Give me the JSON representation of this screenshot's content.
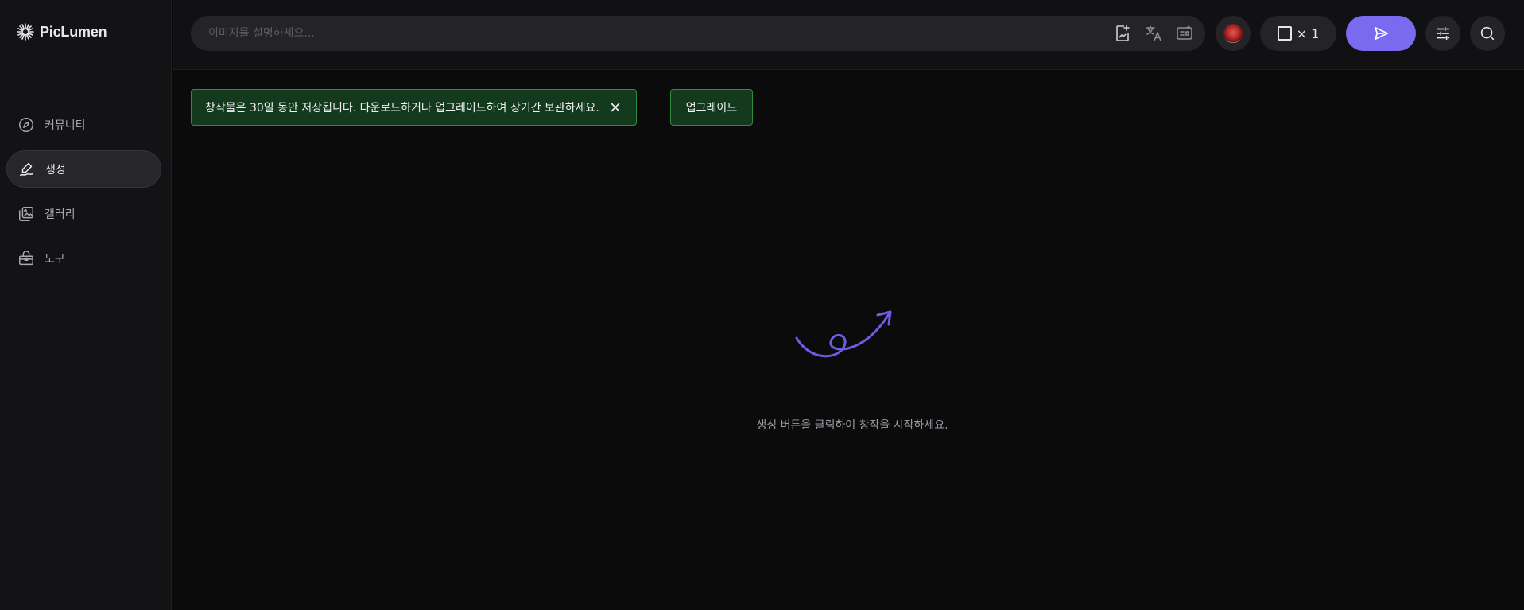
{
  "app": {
    "logo_text": "PicLumen"
  },
  "sidebar": {
    "items": [
      {
        "label": "커뮤니티",
        "icon": "compass-icon",
        "active": false
      },
      {
        "label": "생성",
        "icon": "pen-sign-icon",
        "active": true
      },
      {
        "label": "갤러리",
        "icon": "images-icon",
        "active": false
      },
      {
        "label": "도구",
        "icon": "toolbox-icon",
        "active": false
      }
    ]
  },
  "topbar": {
    "prompt_placeholder": "이미지를 설명하세요...",
    "prompt_value": "",
    "prompt_icons": [
      "image-upload-icon",
      "translate-icon",
      "prompt-enhance-icon"
    ],
    "model_icon": "model-avatar",
    "batch_count": "× 1",
    "generate_icon": "send-icon",
    "settings_icon": "sliders-icon",
    "search_icon": "search-icon"
  },
  "notice": {
    "message": "창작물은 30일 동안 저장됩니다. 다운로드하거나 업그레이드하여 장기간 보관하세요.",
    "close_icon": "close-icon",
    "upgrade_label": "업그레이드"
  },
  "empty_state": {
    "message": "생성 버튼을 클릭하여 창작을 시작하세요.",
    "illustration": "curly-arrow-icon"
  },
  "colors": {
    "accent": "#7a6af0",
    "notice_bg": "#133a1c",
    "notice_border": "#2f8c3f",
    "sidebar_bg": "#131316",
    "main_bg": "#0b0b0c"
  }
}
